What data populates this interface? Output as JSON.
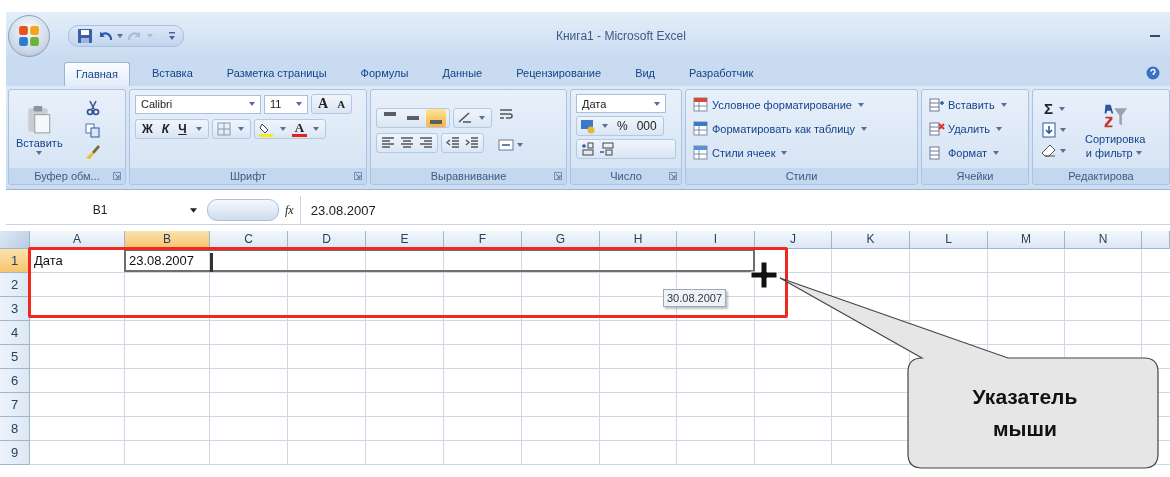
{
  "window": {
    "title": "Книга1 - Microsoft Excel"
  },
  "tabs": [
    {
      "label": "Главная",
      "selected": true
    },
    {
      "label": "Вставка",
      "selected": false
    },
    {
      "label": "Разметка страницы",
      "selected": false
    },
    {
      "label": "Формулы",
      "selected": false
    },
    {
      "label": "Данные",
      "selected": false
    },
    {
      "label": "Рецензирование",
      "selected": false
    },
    {
      "label": "Вид",
      "selected": false
    },
    {
      "label": "Разработчик",
      "selected": false
    }
  ],
  "ribbon": {
    "clipboard": {
      "label": "Буфер обм...",
      "paste": "Вставить"
    },
    "font": {
      "label": "Шрифт",
      "font_name": "Calibri",
      "font_size": "11",
      "grow": "A",
      "shrink": "A",
      "bold": "Ж",
      "italic": "К",
      "underline": "Ч",
      "font_color": "A"
    },
    "alignment": {
      "label": "Выравнивание",
      "vertical_align": [
        {
          "selected": false
        },
        {
          "selected": false
        },
        {
          "selected": true
        }
      ]
    },
    "number": {
      "label": "Число",
      "format": "Дата",
      "percent": "%",
      "thousands": "000"
    },
    "styles": {
      "label": "Стили",
      "items": [
        "Условное форматирование",
        "Форматировать как таблицу",
        "Стили ячеек"
      ]
    },
    "cells": {
      "label": "Ячейки",
      "items": [
        "Вставить",
        "Удалить",
        "Формат"
      ]
    },
    "editing": {
      "label": "Редактирова",
      "sum": "Σ",
      "sort": "Сортировка",
      "sort_line2": "и фильтр"
    }
  },
  "formula_bar": {
    "name_box": "B1",
    "fx": "fx",
    "value": "23.08.2007"
  },
  "sheet": {
    "columns": [
      {
        "label": "A",
        "selected": false
      },
      {
        "label": "B",
        "selected": true
      },
      {
        "label": "C",
        "selected": false
      },
      {
        "label": "D",
        "selected": false
      },
      {
        "label": "E",
        "selected": false
      },
      {
        "label": "F",
        "selected": false
      },
      {
        "label": "G",
        "selected": false
      },
      {
        "label": "H",
        "selected": false
      },
      {
        "label": "I",
        "selected": false
      },
      {
        "label": "J",
        "selected": false
      },
      {
        "label": "K",
        "selected": false
      },
      {
        "label": "L",
        "selected": false
      },
      {
        "label": "M",
        "selected": false
      },
      {
        "label": "N",
        "selected": false
      }
    ],
    "rows": [
      {
        "label": "1",
        "selected": true,
        "cells": [
          "Дата",
          "23.08.2007"
        ]
      },
      {
        "label": "2",
        "selected": false
      },
      {
        "label": "3",
        "selected": false
      },
      {
        "label": "4",
        "selected": false
      },
      {
        "label": "5",
        "selected": false
      },
      {
        "label": "6",
        "selected": false
      },
      {
        "label": "7",
        "selected": false
      },
      {
        "label": "8",
        "selected": false
      },
      {
        "label": "9",
        "selected": false
      }
    ]
  },
  "tooltip": "30.08.2007",
  "callout": "Указатель мыши"
}
